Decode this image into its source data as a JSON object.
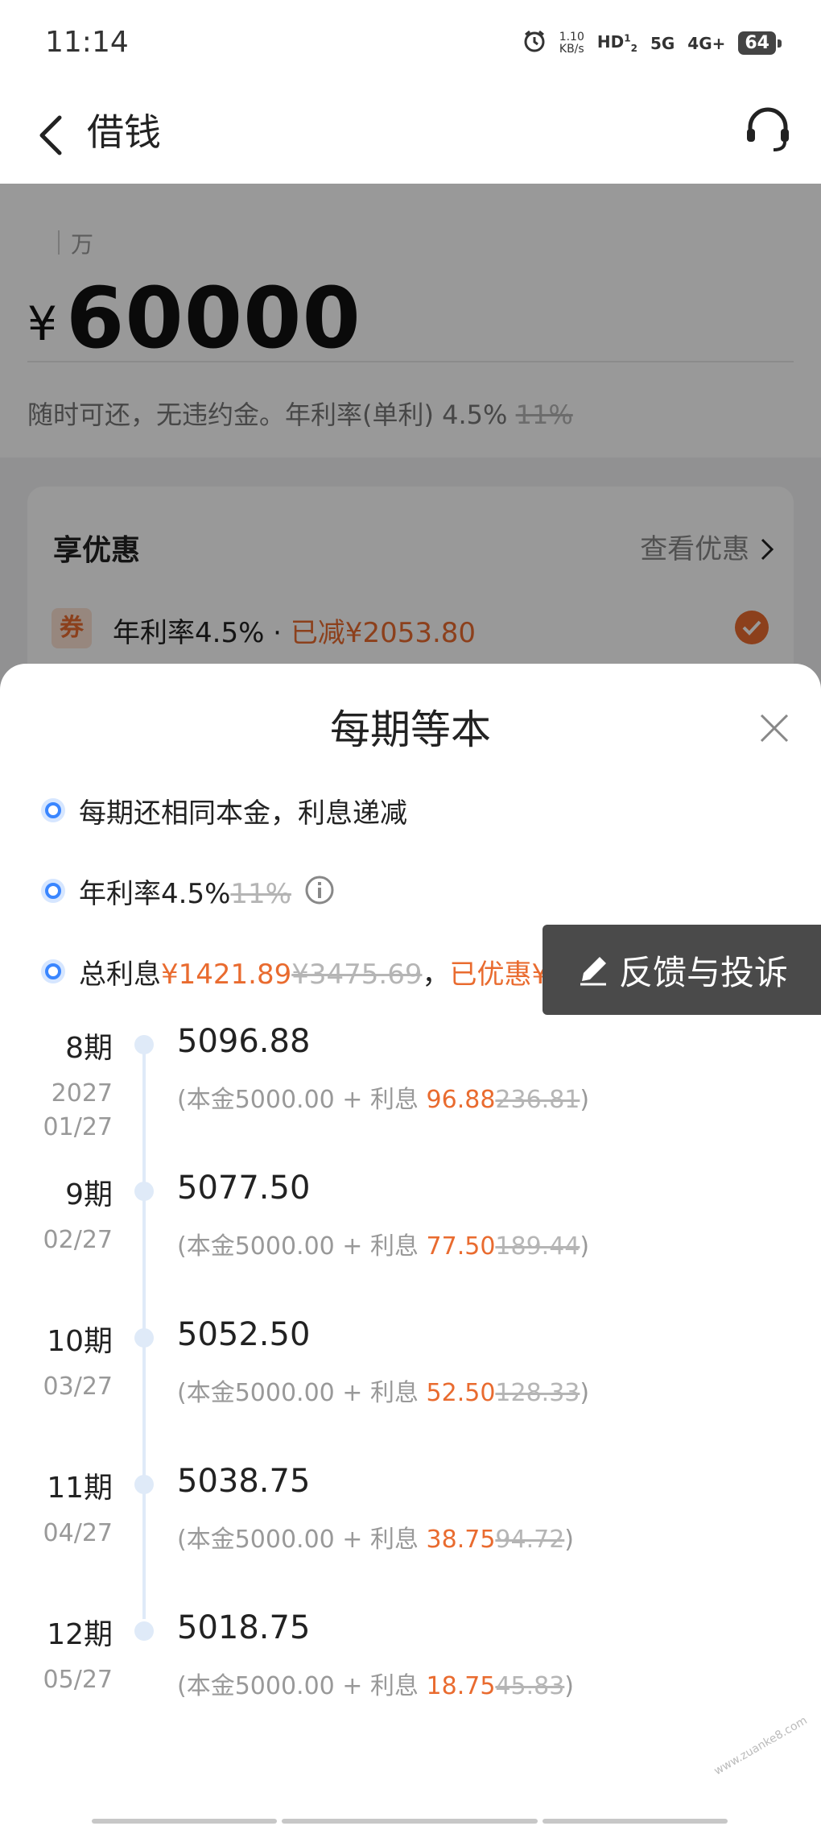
{
  "status_bar": {
    "time": "11:14",
    "net_speed_value": "1.10",
    "net_speed_unit": "KB/s",
    "hd_label": "HD",
    "sim_1": "1",
    "sim_2": "2",
    "signal_5g": "5G",
    "signal_4g": "4G+",
    "battery": "64"
  },
  "nav": {
    "title": "借钱"
  },
  "loan": {
    "unit_label": "万",
    "currency": "¥",
    "amount": "60000",
    "terms_prefix": "随时可还，无违约金。年利率(单利) 4.5% ",
    "terms_old_rate": "11%"
  },
  "discount": {
    "title": "享优惠",
    "link_label": "查看优惠",
    "coupon_badge": "券",
    "coupon_rate": "年利率4.5% · ",
    "coupon_saved": "已减¥2053.80"
  },
  "sheet": {
    "title": "每期等本",
    "bullets": {
      "b1": "每期还相同本金，利息递减",
      "b2_prefix": "年利率4.5%",
      "b2_old": "11%",
      "b3_prefix": "总利息",
      "b3_interest": "¥1421.89",
      "b3_old": "¥3475.69",
      "b3_sep": "，",
      "b3_saved": "已优惠¥2053.80"
    },
    "feedback_label": "反馈与投诉",
    "schedule": [
      {
        "period": "8期",
        "year": "2027",
        "date": "01/27",
        "amount": "5096.88",
        "principal": "(本金5000.00 + 利息 ",
        "interest": "96.88",
        "old_interest": "236.81",
        "close": ")"
      },
      {
        "period": "9期",
        "year": "",
        "date": "02/27",
        "amount": "5077.50",
        "principal": "(本金5000.00 + 利息 ",
        "interest": "77.50",
        "old_interest": "189.44",
        "close": ")"
      },
      {
        "period": "10期",
        "year": "",
        "date": "03/27",
        "amount": "5052.50",
        "principal": "(本金5000.00 + 利息 ",
        "interest": "52.50",
        "old_interest": "128.33",
        "close": ")"
      },
      {
        "period": "11期",
        "year": "",
        "date": "04/27",
        "amount": "5038.75",
        "principal": "(本金5000.00 + 利息 ",
        "interest": "38.75",
        "old_interest": "94.72",
        "close": ")"
      },
      {
        "period": "12期",
        "year": "",
        "date": "05/27",
        "amount": "5018.75",
        "principal": "(本金5000.00 + 利息 ",
        "interest": "18.75",
        "old_interest": "45.83",
        "close": ")"
      }
    ]
  },
  "watermark": "www.zuanke8.com",
  "colors": {
    "accent_orange": "#e96b2f",
    "bullet_blue": "#3a86ff",
    "overlay": "rgba(0,0,0,0.40)"
  }
}
